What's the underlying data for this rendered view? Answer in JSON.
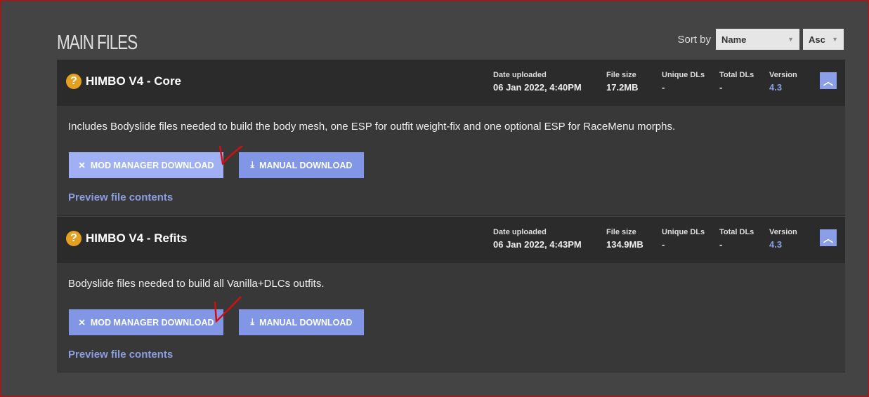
{
  "title": "MAIN FILES",
  "sort": {
    "label": "Sort by",
    "field": "Name",
    "order": "Asc"
  },
  "meta_labels": {
    "date": "Date uploaded",
    "size": "File size",
    "unique": "Unique DLs",
    "total": "Total DLs",
    "version": "Version"
  },
  "files": [
    {
      "name": "HIMBO V4 - Core",
      "date": "06 Jan 2022, 4:40PM",
      "size": "17.2MB",
      "unique": "-",
      "total": "-",
      "version": "4.3",
      "description": "Includes Bodyslide files needed to build the body mesh, one ESP for outfit weight-fix and one optional ESP for RaceMenu morphs.",
      "mod_manager": "MOD MANAGER DOWNLOAD",
      "manual": "MANUAL DOWNLOAD",
      "preview": "Preview file contents"
    },
    {
      "name": "HIMBO V4 - Refits",
      "date": "06 Jan 2022, 4:43PM",
      "size": "134.9MB",
      "unique": "-",
      "total": "-",
      "version": "4.3",
      "description": "Bodyslide files needed to build all Vanilla+DLCs outfits.",
      "mod_manager": "MOD MANAGER DOWNLOAD",
      "manual": "MANUAL DOWNLOAD",
      "preview": "Preview file contents"
    }
  ],
  "colors": {
    "accent": "#8197e6",
    "warning": "#e6a020",
    "annotation": "#d01010"
  }
}
